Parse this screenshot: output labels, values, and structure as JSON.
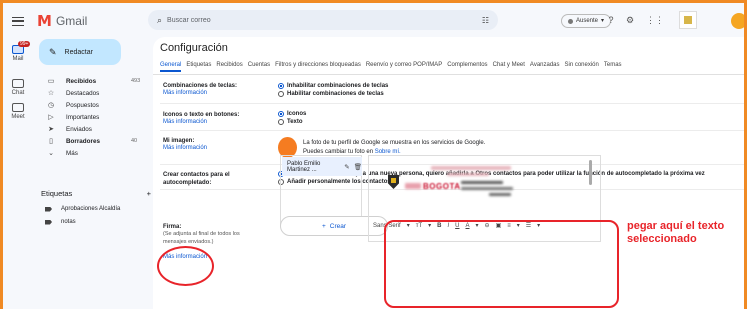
{
  "app": {
    "name": "Gmail"
  },
  "rail": {
    "items": [
      {
        "label": "Mail",
        "icon": "mail-icon",
        "badge": "99+"
      },
      {
        "label": "Chat",
        "icon": "chat-icon"
      },
      {
        "label": "Meet",
        "icon": "meet-icon"
      }
    ]
  },
  "header": {
    "search_placeholder": "Buscar correo",
    "status_label": "Ausente"
  },
  "sidebar": {
    "compose_label": "Redactar",
    "items": [
      {
        "label": "Recibidos",
        "count": "493",
        "icon": "inbox-icon",
        "bold": true
      },
      {
        "label": "Destacados",
        "count": "",
        "icon": "star-icon"
      },
      {
        "label": "Pospuestos",
        "count": "",
        "icon": "clock-icon"
      },
      {
        "label": "Importantes",
        "count": "",
        "icon": "important-icon"
      },
      {
        "label": "Enviados",
        "count": "",
        "icon": "send-icon"
      },
      {
        "label": "Borradores",
        "count": "40",
        "icon": "draft-icon",
        "bold": true
      },
      {
        "label": "Más",
        "count": "",
        "icon": "chevron-down-icon"
      }
    ],
    "labels_title": "Etiquetas",
    "labels_add": "+",
    "labels": [
      "Aprobaciones Alcaldía",
      "notas"
    ]
  },
  "settings": {
    "title": "Configuración",
    "tabs": [
      "General",
      "Etiquetas",
      "Recibidos",
      "Cuentas",
      "Filtros y direcciones bloqueadas",
      "Reenvío y correo POP/IMAP",
      "Complementos",
      "Chat y Meet",
      "Avanzadas",
      "Sin conexión",
      "Temas"
    ],
    "more_info": "Más información",
    "shortcuts": {
      "label": "Combinaciones de teclas:",
      "options": [
        "Inhabilitar combinaciones de teclas",
        "Habilitar combinaciones de teclas"
      ]
    },
    "button_labels": {
      "label": "Iconos o texto en botones:",
      "options": [
        "Iconos",
        "Texto"
      ]
    },
    "my_picture": {
      "label": "Mi imagen:",
      "line1": "La foto de tu perfil de Google se muestra en los servicios de Google.",
      "line2": "Puedes cambiar tu foto en ",
      "link": "Sobre mí."
    },
    "contacts": {
      "label": "Crear contactos para el autocompletado:",
      "options": [
        "Cuando envíe un mensaje a una nueva persona, quiero añadirla a Otros contactos para poder utilizar la función de autocompletado la próxima vez",
        "Añadir personalmente los contactos"
      ]
    },
    "signature": {
      "label": "Firma:",
      "note": "(Se adjunta al final de todos los mensajes enviados.)",
      "items": [
        "Pablo Emilio Martinez ..."
      ],
      "create_label": "Crear",
      "editor_logo_text": "BOGOTA",
      "toolbar": [
        "Sans Serif",
        "▾",
        "тT",
        "▾",
        "B",
        "I",
        "U",
        "A",
        "▾",
        "⊖",
        "▣",
        "≡",
        "▾",
        "☰",
        "▾"
      ]
    }
  },
  "annotation": {
    "text": "pegar aquí el texto seleccionado",
    "color": "#e8242a"
  },
  "colors": {
    "accent": "#0b57d0",
    "compose_bg": "#c2e7ff",
    "frame": "#f08a24"
  }
}
